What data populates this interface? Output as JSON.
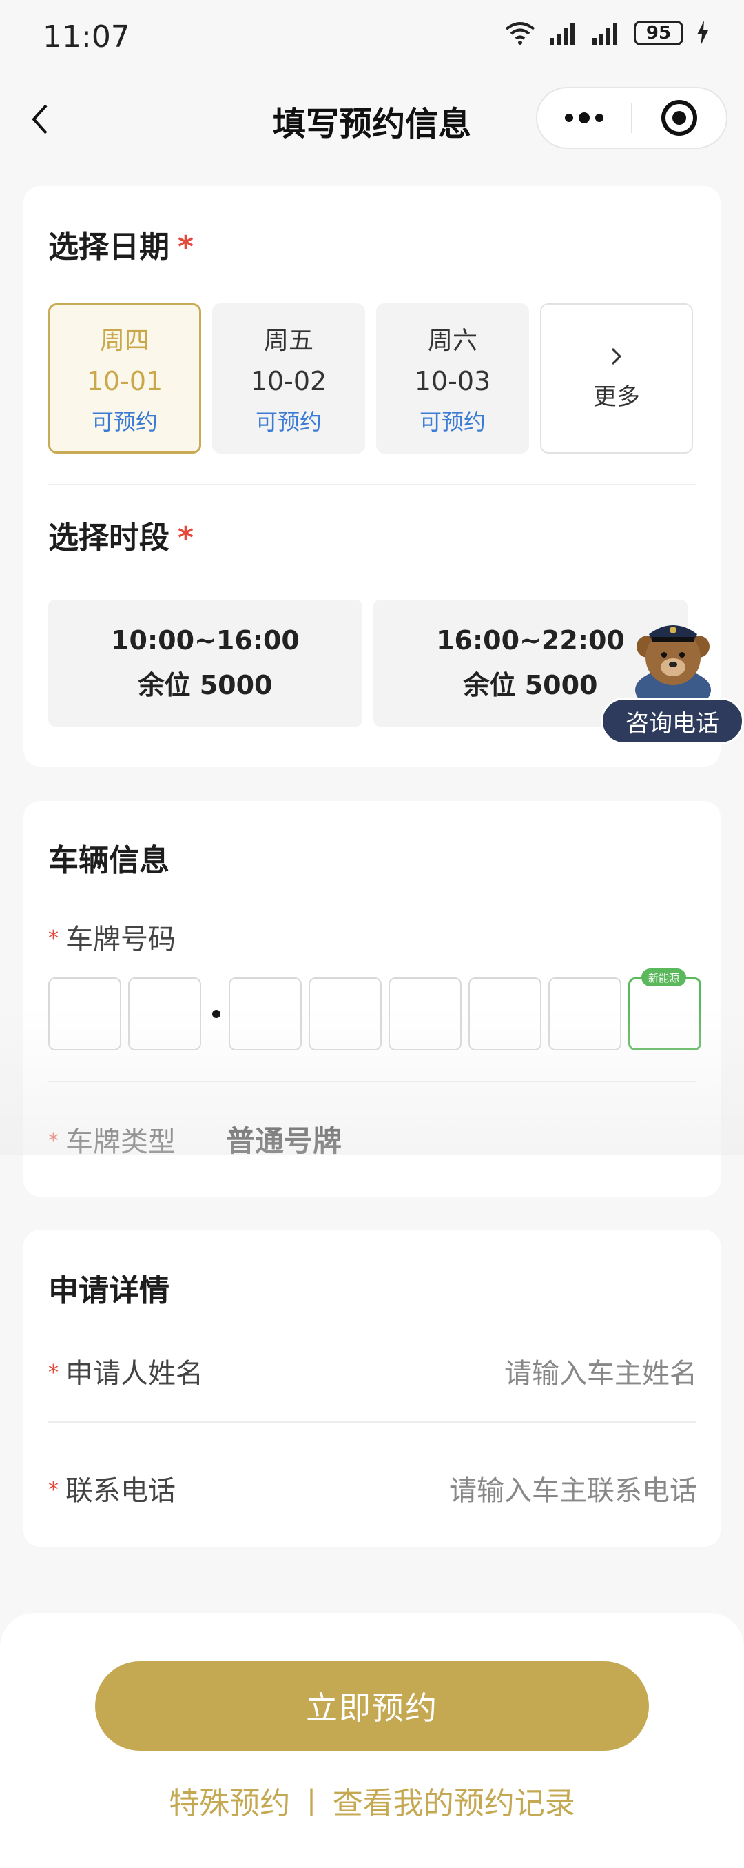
{
  "status_bar": {
    "time": "11:07",
    "battery": "95"
  },
  "nav": {
    "title": "填写预约信息"
  },
  "date_section": {
    "title": "选择日期",
    "required_mark": "*",
    "dates": [
      {
        "week": "周四",
        "day": "10-01",
        "status": "可预约",
        "selected": true
      },
      {
        "week": "周五",
        "day": "10-02",
        "status": "可预约",
        "selected": false
      },
      {
        "week": "周六",
        "day": "10-03",
        "status": "可预约",
        "selected": false
      }
    ],
    "more_label": "更多"
  },
  "slot_section": {
    "title": "选择时段",
    "required_mark": "*",
    "slots": [
      {
        "time": "10:00~16:00",
        "remain": "余位 5000"
      },
      {
        "time": "16:00~22:00",
        "remain": "余位 5000"
      }
    ]
  },
  "consult": {
    "label": "咨询电话"
  },
  "vehicle_section": {
    "title": "车辆信息",
    "required_mark": "*",
    "plate_label": "车牌号码",
    "new_energy_badge": "新能源",
    "plate_type_label": "车牌类型",
    "plate_type_value": "普通号牌"
  },
  "apply_section": {
    "title": "申请详情",
    "required_mark": "*",
    "name_label": "申请人姓名",
    "name_placeholder": "请输入车主姓名",
    "phone_label": "联系电话",
    "phone_placeholder": "请输入车主联系电话"
  },
  "actions": {
    "submit_label": "立即预约",
    "special_link": "特殊预约",
    "separator": "|",
    "records_link": "查看我的预约记录"
  },
  "colors": {
    "accent_gold": "#c5a852",
    "available_blue": "#3a7bd5",
    "required_red": "#e5483c",
    "new_energy_green": "#5cb85c"
  }
}
